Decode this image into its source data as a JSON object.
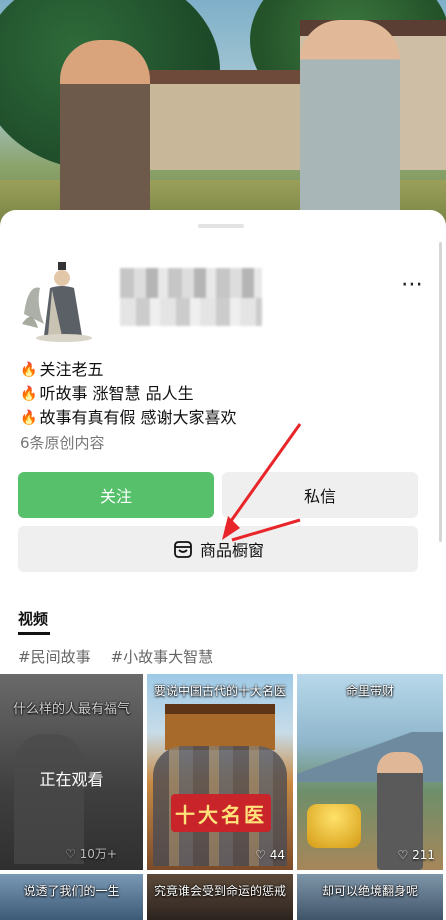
{
  "profile": {
    "bio": [
      "关注老五",
      "听故事 涨智慧 品人生",
      "故事有真有假 感谢大家喜欢"
    ],
    "works_count": "6条原创内容",
    "more_icon": "⋯"
  },
  "actions": {
    "follow": "关注",
    "message": "私信",
    "shop": "商品橱窗"
  },
  "tabs": {
    "active": "视频"
  },
  "tags": [
    "#民间故事",
    "#小故事大智慧"
  ],
  "videos": [
    {
      "caption": "什么样的人最有福气",
      "overlay": "正在观看",
      "likes": "♡ 10万+"
    },
    {
      "caption": "要说中国古代的十大名医",
      "badge": "十大名医",
      "likes": "♡ 44"
    },
    {
      "caption": "命里带财",
      "likes": "♡ 211"
    },
    {
      "caption": "说透了我们的一生"
    },
    {
      "caption": "究竟谁会受到命运的惩戒"
    },
    {
      "caption": "却可以绝境翻身呢"
    }
  ],
  "colors": {
    "follow_button": "#57c06a",
    "secondary_button": "#efefef",
    "fire": "#ff5a1f",
    "annotation_arrow": "#e8262a"
  }
}
